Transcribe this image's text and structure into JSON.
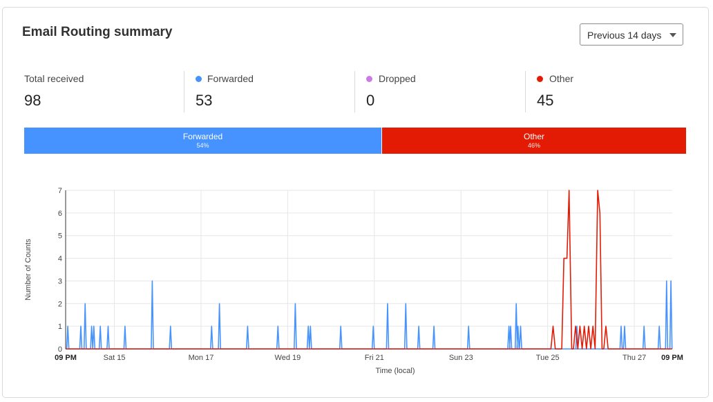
{
  "card": {
    "title": "Email Routing summary",
    "range_select": {
      "value": "Previous 14 days"
    }
  },
  "stats": [
    {
      "name": "Total received",
      "value": "98",
      "color": ""
    },
    {
      "name": "Forwarded",
      "value": "53",
      "color": "#4693ff"
    },
    {
      "name": "Dropped",
      "value": "0",
      "color": "#cd7ae9"
    },
    {
      "name": "Other",
      "value": "45",
      "color": "#e31b05"
    }
  ],
  "share_bar": [
    {
      "label": "Forwarded",
      "percent": "54%",
      "fraction": 0.54,
      "color": "#4693ff"
    },
    {
      "label": "Other",
      "percent": "46%",
      "fraction": 0.46,
      "color": "#e31b05"
    }
  ],
  "chart_data": {
    "type": "line",
    "xlabel": "Time (local)",
    "ylabel": "Number of Counts",
    "ylim": [
      0,
      7
    ],
    "y_ticks": [
      "0",
      "1",
      "2",
      "3",
      "4",
      "5",
      "6",
      "7"
    ],
    "xlim": [
      0,
      14
    ],
    "x_ticks": [
      {
        "label": "09 PM",
        "x": 0,
        "bold": true
      },
      {
        "label": "Sat 15",
        "x": 1.125
      },
      {
        "label": "Mon 17",
        "x": 3.125
      },
      {
        "label": "Wed 19",
        "x": 5.125
      },
      {
        "label": "Fri 21",
        "x": 7.125
      },
      {
        "label": "Sun 23",
        "x": 9.125
      },
      {
        "label": "Tue 25",
        "x": 11.125
      },
      {
        "label": "Thu 27",
        "x": 13.125
      },
      {
        "label": "09 PM",
        "x": 14,
        "bold": true
      }
    ],
    "grid": true,
    "legend": "none",
    "series": [
      {
        "color": "#4693ff",
        "spikes": [
          [
            0.05,
            1
          ],
          [
            0.35,
            1
          ],
          [
            0.45,
            2
          ],
          [
            0.6,
            1
          ],
          [
            0.65,
            1
          ],
          [
            0.8,
            1
          ],
          [
            0.98,
            1
          ],
          [
            1.37,
            1
          ],
          [
            2.0,
            3
          ],
          [
            2.42,
            1
          ],
          [
            3.37,
            1
          ],
          [
            3.55,
            2
          ],
          [
            4.2,
            1
          ],
          [
            4.9,
            1
          ],
          [
            5.3,
            2
          ],
          [
            5.6,
            1
          ],
          [
            5.65,
            1
          ],
          [
            6.35,
            1
          ],
          [
            7.1,
            1
          ],
          [
            7.43,
            2
          ],
          [
            7.85,
            2
          ],
          [
            8.15,
            1
          ],
          [
            8.5,
            1
          ],
          [
            9.3,
            1
          ],
          [
            10.23,
            1
          ],
          [
            10.27,
            1
          ],
          [
            10.4,
            2
          ],
          [
            10.44,
            1
          ],
          [
            10.5,
            1
          ],
          [
            11.8,
            1
          ],
          [
            12.82,
            1
          ],
          [
            12.9,
            1
          ],
          [
            13.35,
            1
          ],
          [
            13.7,
            1
          ],
          [
            13.87,
            3
          ],
          [
            13.97,
            3
          ]
        ]
      },
      {
        "color": "#e31b05",
        "points": [
          [
            0,
            0
          ],
          [
            11.2,
            0
          ],
          [
            11.25,
            1
          ],
          [
            11.3,
            0
          ],
          [
            11.45,
            0
          ],
          [
            11.5,
            4
          ],
          [
            11.57,
            4
          ],
          [
            11.62,
            7
          ],
          [
            11.68,
            0
          ],
          [
            11.72,
            0
          ],
          [
            11.77,
            1
          ],
          [
            11.82,
            0
          ],
          [
            11.87,
            1
          ],
          [
            11.92,
            0
          ],
          [
            11.97,
            1
          ],
          [
            12.02,
            0
          ],
          [
            12.07,
            1
          ],
          [
            12.12,
            0
          ],
          [
            12.17,
            1
          ],
          [
            12.22,
            0
          ],
          [
            12.28,
            7
          ],
          [
            12.33,
            6
          ],
          [
            12.38,
            0
          ],
          [
            12.42,
            0
          ],
          [
            12.47,
            1
          ],
          [
            12.52,
            0
          ],
          [
            14,
            0
          ]
        ]
      }
    ]
  }
}
